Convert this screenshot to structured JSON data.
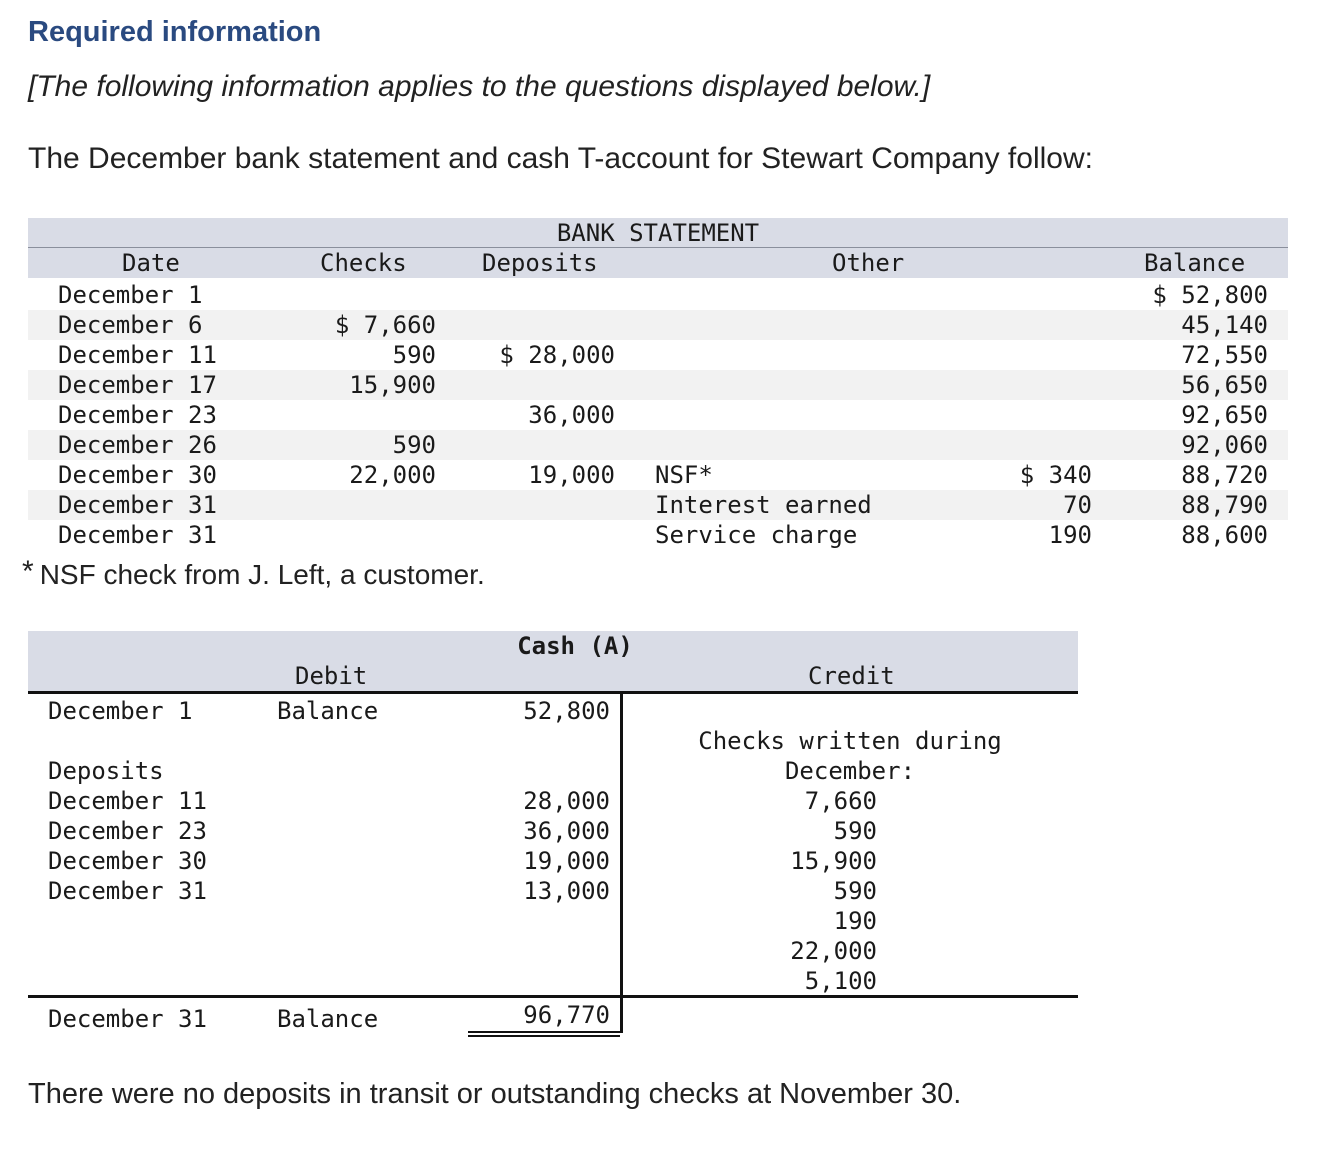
{
  "heading": "Required information",
  "intro": "[The following information applies to the questions displayed below.]",
  "lead": "The December bank statement and cash T-account for Stewart Company follow:",
  "bank_statement": {
    "title": "BANK STATEMENT",
    "headers": {
      "date": "Date",
      "checks": "Checks",
      "deposits": "Deposits",
      "other": "Other",
      "balance": "Balance"
    },
    "rows": [
      {
        "date": "December 1",
        "checks": "",
        "deposits": "",
        "other_label": "",
        "other_amount": "",
        "balance": "$ 52,800"
      },
      {
        "date": "December 6",
        "checks": "$ 7,660",
        "deposits": "",
        "other_label": "",
        "other_amount": "",
        "balance": "45,140"
      },
      {
        "date": "December 11",
        "checks": "590",
        "deposits": "$ 28,000",
        "other_label": "",
        "other_amount": "",
        "balance": "72,550"
      },
      {
        "date": "December 17",
        "checks": "15,900",
        "deposits": "",
        "other_label": "",
        "other_amount": "",
        "balance": "56,650"
      },
      {
        "date": "December 23",
        "checks": "",
        "deposits": "36,000",
        "other_label": "",
        "other_amount": "",
        "balance": "92,650"
      },
      {
        "date": "December 26",
        "checks": "590",
        "deposits": "",
        "other_label": "",
        "other_amount": "",
        "balance": "92,060"
      },
      {
        "date": "December 30",
        "checks": "22,000",
        "deposits": "19,000",
        "other_label": "NSF*",
        "other_amount": "$ 340",
        "balance": "88,720"
      },
      {
        "date": "December 31",
        "checks": "",
        "deposits": "",
        "other_label": "Interest earned",
        "other_amount": "70",
        "balance": "88,790"
      },
      {
        "date": "December 31",
        "checks": "",
        "deposits": "",
        "other_label": "Service charge",
        "other_amount": "190",
        "balance": "88,600"
      }
    ],
    "footnote_mark": "*",
    "footnote": "NSF check from J. Left, a customer."
  },
  "t_account": {
    "title": "Cash (A)",
    "debit_header": "Debit",
    "credit_header": "Credit",
    "opening": {
      "date": "December 1",
      "label": "Balance",
      "amount": "52,800"
    },
    "deposits_label": "Deposits",
    "deposits": [
      {
        "date": "December 11",
        "amount": "28,000"
      },
      {
        "date": "December 23",
        "amount": "36,000"
      },
      {
        "date": "December 30",
        "amount": "19,000"
      },
      {
        "date": "December 31",
        "amount": "13,000"
      }
    ],
    "credit_label_1": "Checks written during",
    "credit_label_2": "December:",
    "checks": [
      "7,660",
      "590",
      "15,900",
      "590",
      "190",
      "22,000",
      "5,100"
    ],
    "closing": {
      "date": "December 31",
      "label": "Balance",
      "amount": "96,770"
    }
  },
  "closing_note": "There were no deposits in transit or outstanding checks at November 30."
}
